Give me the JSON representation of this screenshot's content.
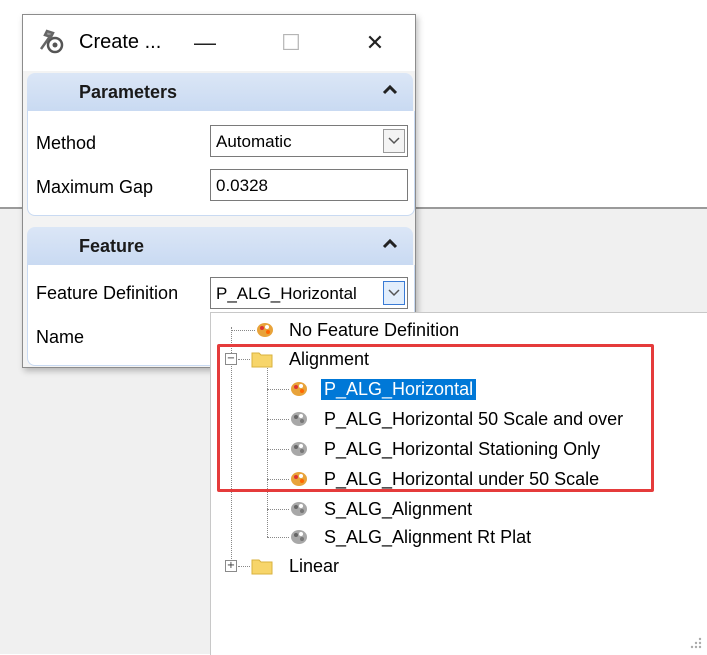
{
  "dialog": {
    "title": "Create ...",
    "window_controls": {
      "minimize": "—",
      "maximize": "☐",
      "close": "✕"
    }
  },
  "parameters": {
    "header": "Parameters",
    "method_label": "Method",
    "method_value": "Automatic",
    "max_gap_label": "Maximum Gap",
    "max_gap_value": "0.0328"
  },
  "feature": {
    "header": "Feature",
    "feature_def_label": "Feature Definition",
    "feature_def_value": "P_ALG_Horizontal",
    "name_label": "Name"
  },
  "tree": {
    "items": [
      {
        "label": "No Feature Definition",
        "icon": "feature-palette-icon"
      },
      {
        "label": "Alignment",
        "icon": "folder-icon",
        "expanded": true
      },
      {
        "label": "P_ALG_Horizontal",
        "icon": "feature-palette-icon",
        "selected": true
      },
      {
        "label": "P_ALG_Horizontal 50 Scale and over",
        "icon": "feature-palette-gray-icon"
      },
      {
        "label": "P_ALG_Horizontal Stationing Only",
        "icon": "feature-palette-gray-icon"
      },
      {
        "label": "P_ALG_Horizontal under 50 Scale",
        "icon": "feature-palette-icon"
      },
      {
        "label": "S_ALG_Alignment",
        "icon": "feature-palette-gray-icon"
      },
      {
        "label": "S_ALG_Alignment Rt Plat",
        "icon": "feature-palette-gray-icon"
      },
      {
        "label": "Linear",
        "icon": "folder-icon",
        "expanded": false
      }
    ]
  },
  "colors": {
    "selection": "#0078d7",
    "highlight_box": "#e53b3b",
    "section_header": "#c9daf2"
  }
}
